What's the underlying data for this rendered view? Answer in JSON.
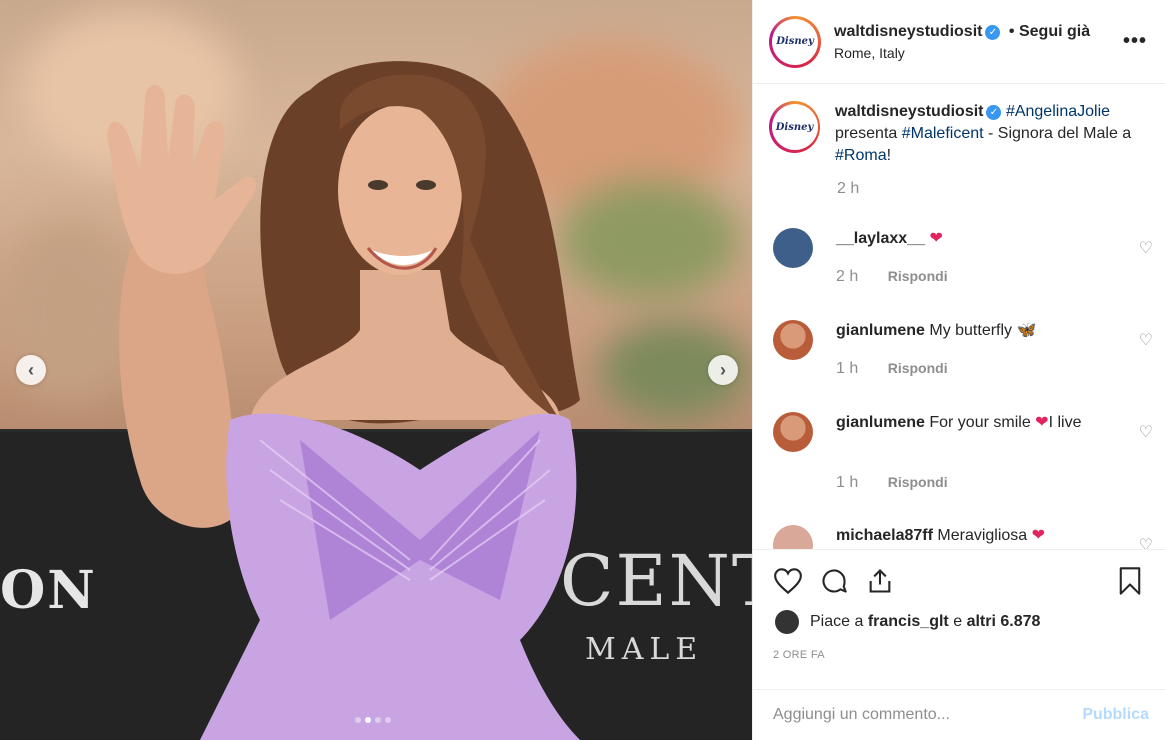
{
  "post": {
    "username": "waltdisneystudiosit",
    "verified": true,
    "follow_status": "Segui già",
    "location": "Rome, Italy",
    "avatar_text": "Disney",
    "more_icon": "more-icon"
  },
  "photo": {
    "backdrop_text_left": "ON",
    "backdrop_text_title": "CENT",
    "backdrop_text_sub": "MALE",
    "dots_count": 4,
    "active_dot": 1
  },
  "caption": {
    "username": "waltdisneystudiosit",
    "hashtag1": "#AngelinaJolie",
    "text1": "presenta",
    "hashtag2": "#Maleficent",
    "text2": "- Signora del Male a",
    "hashtag3": "#Roma",
    "text3": "!",
    "time": "2 h"
  },
  "comments": [
    {
      "username": "__laylaxx__",
      "text": "",
      "emoji": "❤",
      "time": "2 h",
      "reply": "Rispondi",
      "avatar_color": "#3e5f8a"
    },
    {
      "username": "gianlumene",
      "text": "My butterfly",
      "emoji": "🦋",
      "time": "1 h",
      "reply": "Rispondi",
      "avatar_color": "#b85c3a"
    },
    {
      "username": "gianlumene",
      "text": "For your smile",
      "emoji": "❤",
      "text_after": "I live",
      "time": "1 h",
      "reply": "Rispondi",
      "avatar_color": "#b85c3a"
    },
    {
      "username": "michaela87ff",
      "text": "Meravigliosa",
      "emoji": "❤",
      "avatar_color": "#d9a899"
    }
  ],
  "actions": {
    "likes_prefix": "Piace a",
    "likes_user": "francis_glt",
    "likes_join": "e",
    "likes_others": "altri 6.878",
    "time_ago": "2 ORE FA"
  },
  "add_comment": {
    "placeholder": "Aggiungi un commento...",
    "publish_label": "Pubblica"
  },
  "colors": {
    "link": "#003569",
    "verified": "#3897f0",
    "publish_disabled": "#b3dbff",
    "muted": "#8e8e8e"
  }
}
